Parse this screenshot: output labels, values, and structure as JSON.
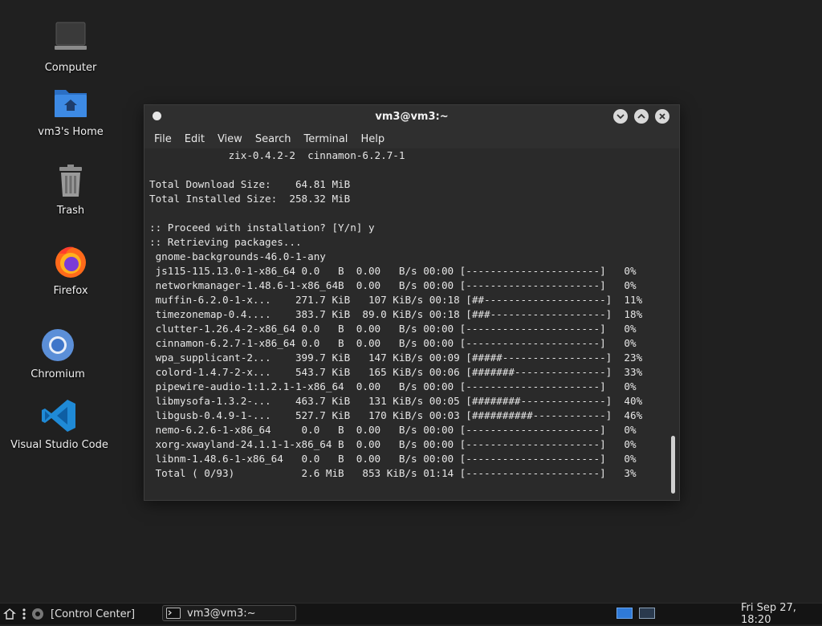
{
  "desktop": {
    "icons": [
      {
        "label": "Computer"
      },
      {
        "label": "vm3's Home"
      },
      {
        "label": "Trash"
      },
      {
        "label": "Firefox"
      },
      {
        "label": "Chromium"
      },
      {
        "label": "Visual Studio Code"
      }
    ]
  },
  "window": {
    "title": "vm3@vm3:~",
    "menu": [
      "File",
      "Edit",
      "View",
      "Search",
      "Terminal",
      "Help"
    ]
  },
  "terminal": {
    "lines": [
      "             zix-0.4.2-2  cinnamon-6.2.7-1",
      "",
      "Total Download Size:    64.81 MiB",
      "Total Installed Size:  258.32 MiB",
      "",
      ":: Proceed with installation? [Y/n] y",
      ":: Retrieving packages...",
      " gnome-backgrounds-46.0-1-any",
      " js115-115.13.0-1-x86_64 0.0   B  0.00   B/s 00:00 [----------------------]   0%",
      " networkmanager-1.48.6-1-x86_64B  0.00   B/s 00:00 [----------------------]   0%",
      " muffin-6.2.0-1-x...    271.7 KiB   107 KiB/s 00:18 [##--------------------]  11%",
      " timezonemap-0.4....    383.7 KiB  89.0 KiB/s 00:18 [###-------------------]  18%",
      " clutter-1.26.4-2-x86_64 0.0   B  0.00   B/s 00:00 [----------------------]   0%",
      " cinnamon-6.2.7-1-x86_64 0.0   B  0.00   B/s 00:00 [----------------------]   0%",
      " wpa_supplicant-2...    399.7 KiB   147 KiB/s 00:09 [#####-----------------]  23%",
      " colord-1.4.7-2-x...    543.7 KiB   165 KiB/s 00:06 [#######---------------]  33%",
      " pipewire-audio-1:1.2.1-1-x86_64  0.00   B/s 00:00 [----------------------]   0%",
      " libmysofa-1.3.2-...    463.7 KiB   131 KiB/s 00:05 [########--------------]  40%",
      " libgusb-0.4.9-1-...    527.7 KiB   170 KiB/s 00:03 [##########------------]  46%",
      " nemo-6.2.6-1-x86_64     0.0   B  0.00   B/s 00:00 [----------------------]   0%",
      " xorg-xwayland-24.1.1-1-x86_64 B  0.00   B/s 00:00 [----------------------]   0%",
      " libnm-1.48.6-1-x86_64   0.0   B  0.00   B/s 00:00 [----------------------]   0%",
      " Total ( 0/93)           2.6 MiB   853 KiB/s 01:14 [----------------------]   3%"
    ]
  },
  "taskbar": {
    "control_center": "[Control Center]",
    "task_label": "vm3@vm3:~",
    "clock": "Fri Sep 27, 18:20"
  },
  "colors": {
    "desktop_bg": "#202020",
    "terminal_bg": "#2a2a2a",
    "accent_blue": "#2f7ad8"
  }
}
